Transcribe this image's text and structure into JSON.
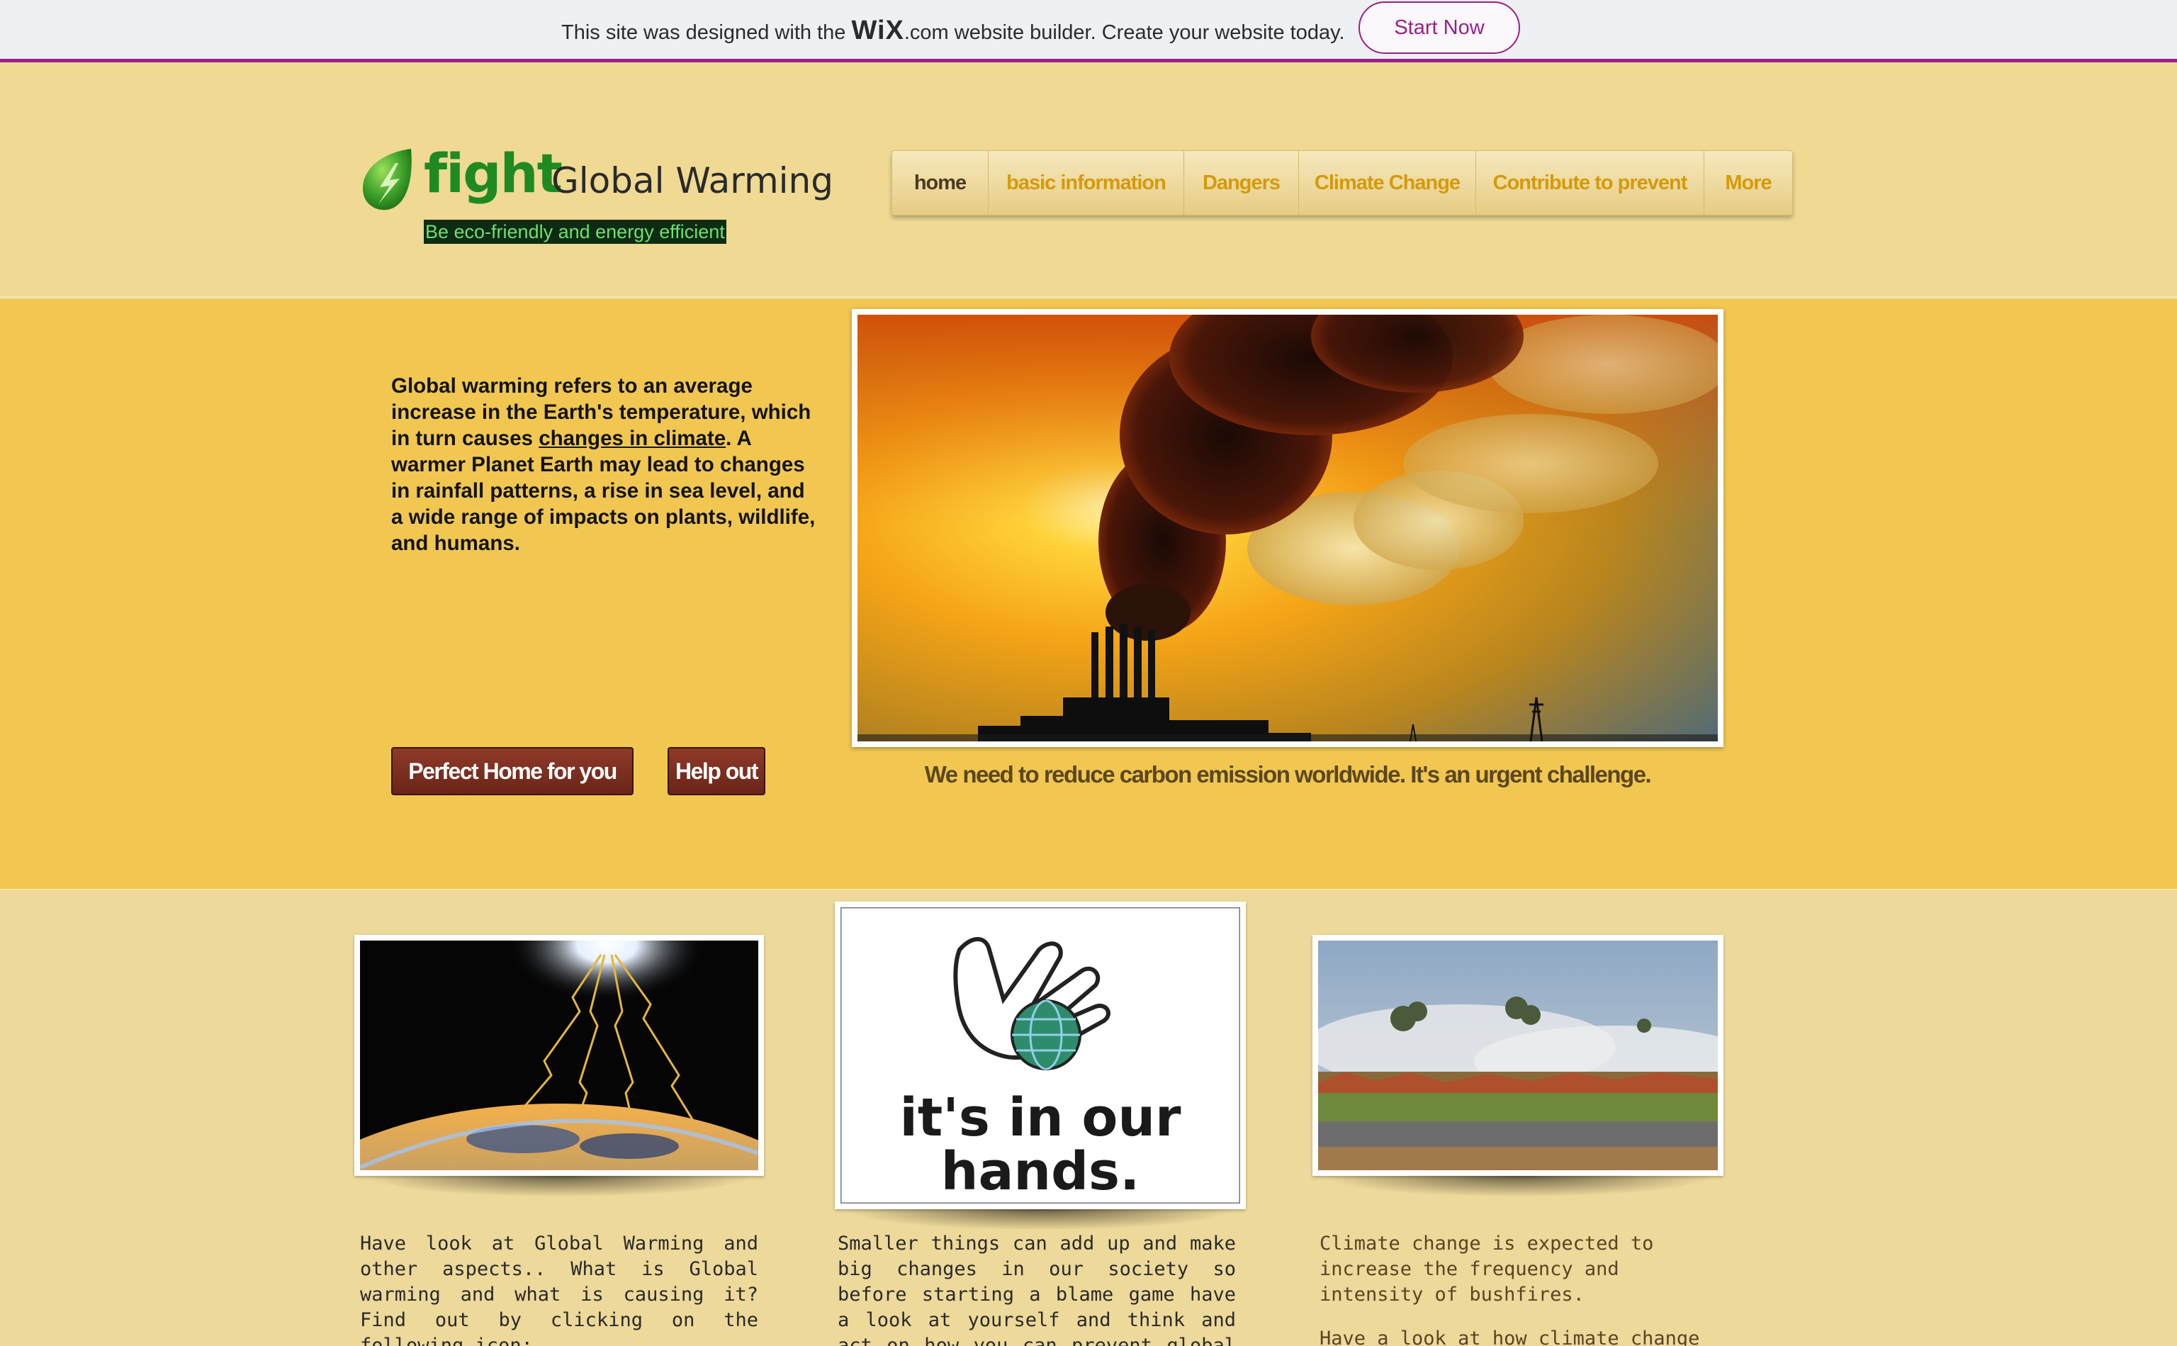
{
  "wix_banner": {
    "text_before": "This site was designed with the ",
    "logo": "WiX",
    "text_after": ".com website builder. Create your website today.",
    "button_label": "Start Now"
  },
  "header": {
    "logo_word": "fight",
    "logo_text": "Global Warming",
    "tagline": "Be eco-friendly and energy efficient",
    "logo_icon": "leaf-icon"
  },
  "nav": {
    "items": [
      {
        "label": "home",
        "active": true
      },
      {
        "label": "basic information",
        "active": false
      },
      {
        "label": "Dangers",
        "active": false
      },
      {
        "label": "Climate Change",
        "active": false
      },
      {
        "label": "Contribute to prevent",
        "active": false
      },
      {
        "label": "More",
        "active": false
      }
    ]
  },
  "hero": {
    "intro_before": "Global warming refers to an average increase in the Earth's temperature, which in turn causes ",
    "intro_link": "changes in climate",
    "intro_after": ". A warmer Planet Earth may lead to changes in rainfall patterns, a rise in sea level, and a wide range of impacts on plants, wildlife, and humans.",
    "button_home": "Perfect Home for you",
    "button_help": "Help out",
    "image_alt": "smokestack pollution at sunset",
    "caption": "We need to reduce carbon emission worldwide. It's an urgent challenge."
  },
  "cards": [
    {
      "image_alt": "sun rays hitting earth",
      "text": "Have look at Global Warming and other aspects.. What is Global warming and what is causing it? Find out by clicking on the following icon:"
    },
    {
      "image_alt": "hand holding globe",
      "image_text_line1": "it's in our",
      "image_text_line2": "hands.",
      "text": "Smaller things can add up and make big changes in our society so before starting a blame game have a look at yourself and think and act on how you can prevent global warming!"
    },
    {
      "image_alt": "bushfire by roadside",
      "text_p1": "Climate change is expected to increase the frequency and intensity of bushfires.",
      "text_p2": "Have a look at how climate change can harm our world in many ways."
    }
  ],
  "colors": {
    "wix_accent": "#9a1f8c",
    "logo_green": "#1f8a22",
    "nav_text": "#d59a0c",
    "hero_bg": "#f1c752",
    "button_brown": "#7a2e20"
  }
}
